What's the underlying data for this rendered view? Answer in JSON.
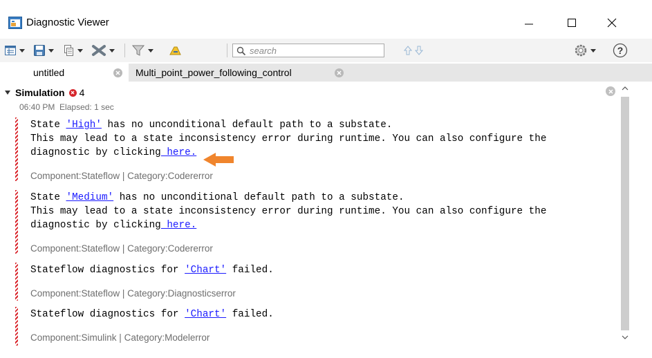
{
  "window": {
    "title": "Diagnostic Viewer"
  },
  "search": {
    "placeholder": "search"
  },
  "tabs": [
    {
      "label": "untitled"
    },
    {
      "label": "Multi_point_power_following_control"
    }
  ],
  "simulation": {
    "title": "Simulation",
    "error_count": "4",
    "time": "06:40 PM",
    "elapsed": "Elapsed: 1 sec"
  },
  "diagnostics": [
    {
      "pre": "State ",
      "link": "'High'",
      "post": " has no unconditional default path to a substate.",
      "line2": "This may lead to a state inconsistency error during runtime. You can also configure the",
      "line3_pre": "diagnostic by clicking",
      "line3_link": " here.",
      "meta": "Component:Stateflow | Category:Codererror"
    },
    {
      "pre": "State ",
      "link": "'Medium'",
      "post": " has no unconditional default path to a substate.",
      "line2": "This may lead to a state inconsistency error during runtime. You can also configure the",
      "line3_pre": "diagnostic by clicking",
      "line3_link": " here.",
      "meta": "Component:Stateflow | Category:Codererror"
    },
    {
      "pre": "Stateflow diagnostics for ",
      "link": "'Chart'",
      "post": " failed.",
      "meta": "Component:Stateflow | Category:Diagnosticserror"
    },
    {
      "pre": "Stateflow diagnostics for ",
      "link": "'Chart'",
      "post": " failed.",
      "meta": "Component:Simulink | Category:Modelerror"
    }
  ],
  "colors": {
    "error": "#d6262b",
    "link": "#1a1aff",
    "annotation_arrow": "#f0852d",
    "toolbar_bg": "#f3f3f3"
  },
  "icons": [
    "app-icon",
    "minimize-icon",
    "maximize-icon",
    "close-icon",
    "report-icon",
    "save-icon",
    "copy-icon",
    "clear-icon",
    "filter-icon",
    "highlight-icon",
    "search-icon",
    "up-arrow-icon",
    "down-arrow-icon",
    "settings-icon",
    "help-icon",
    "collapse-triangle-icon"
  ]
}
